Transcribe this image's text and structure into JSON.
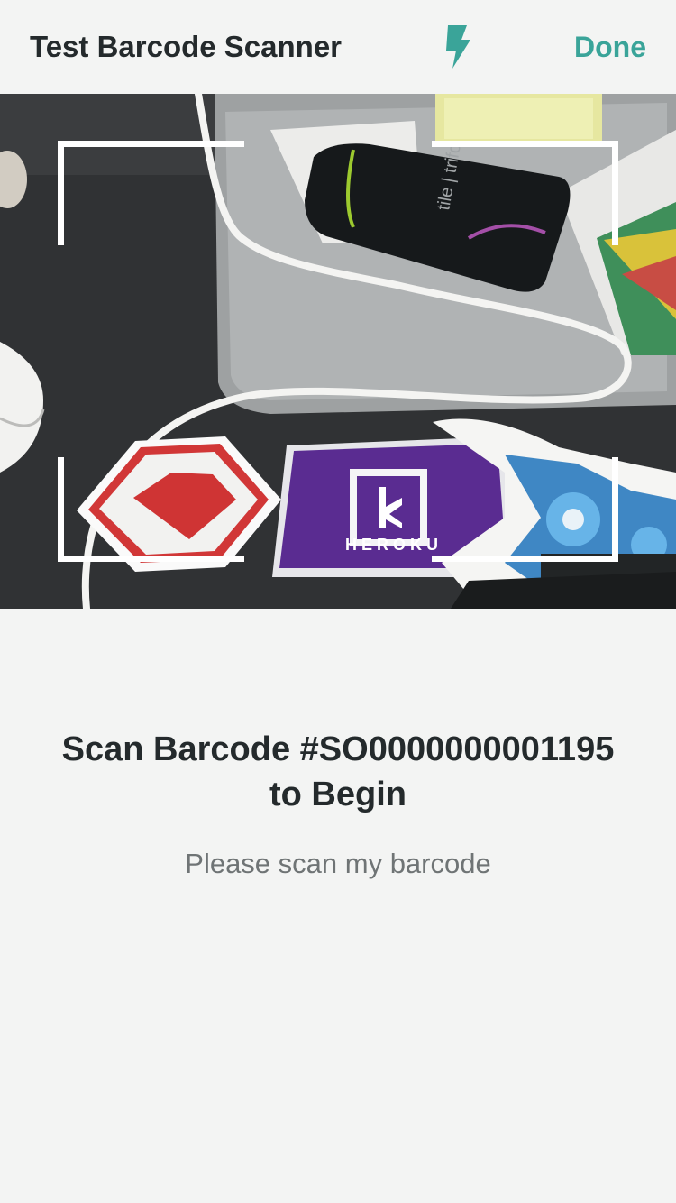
{
  "header": {
    "title": "Test Barcode Scanner",
    "flash_icon": "flash-icon",
    "done_label": "Done"
  },
  "camera": {
    "sticker_text": "HEROKU",
    "device_text": "tile | trifo"
  },
  "prompt": {
    "heading": "Scan Barcode #SO0000000001195 to Begin",
    "subtext": "Please scan my barcode"
  },
  "colors": {
    "accent": "#3aa499",
    "background": "#f3f4f3",
    "text": "#242a2c",
    "subtext": "#6f7475"
  }
}
